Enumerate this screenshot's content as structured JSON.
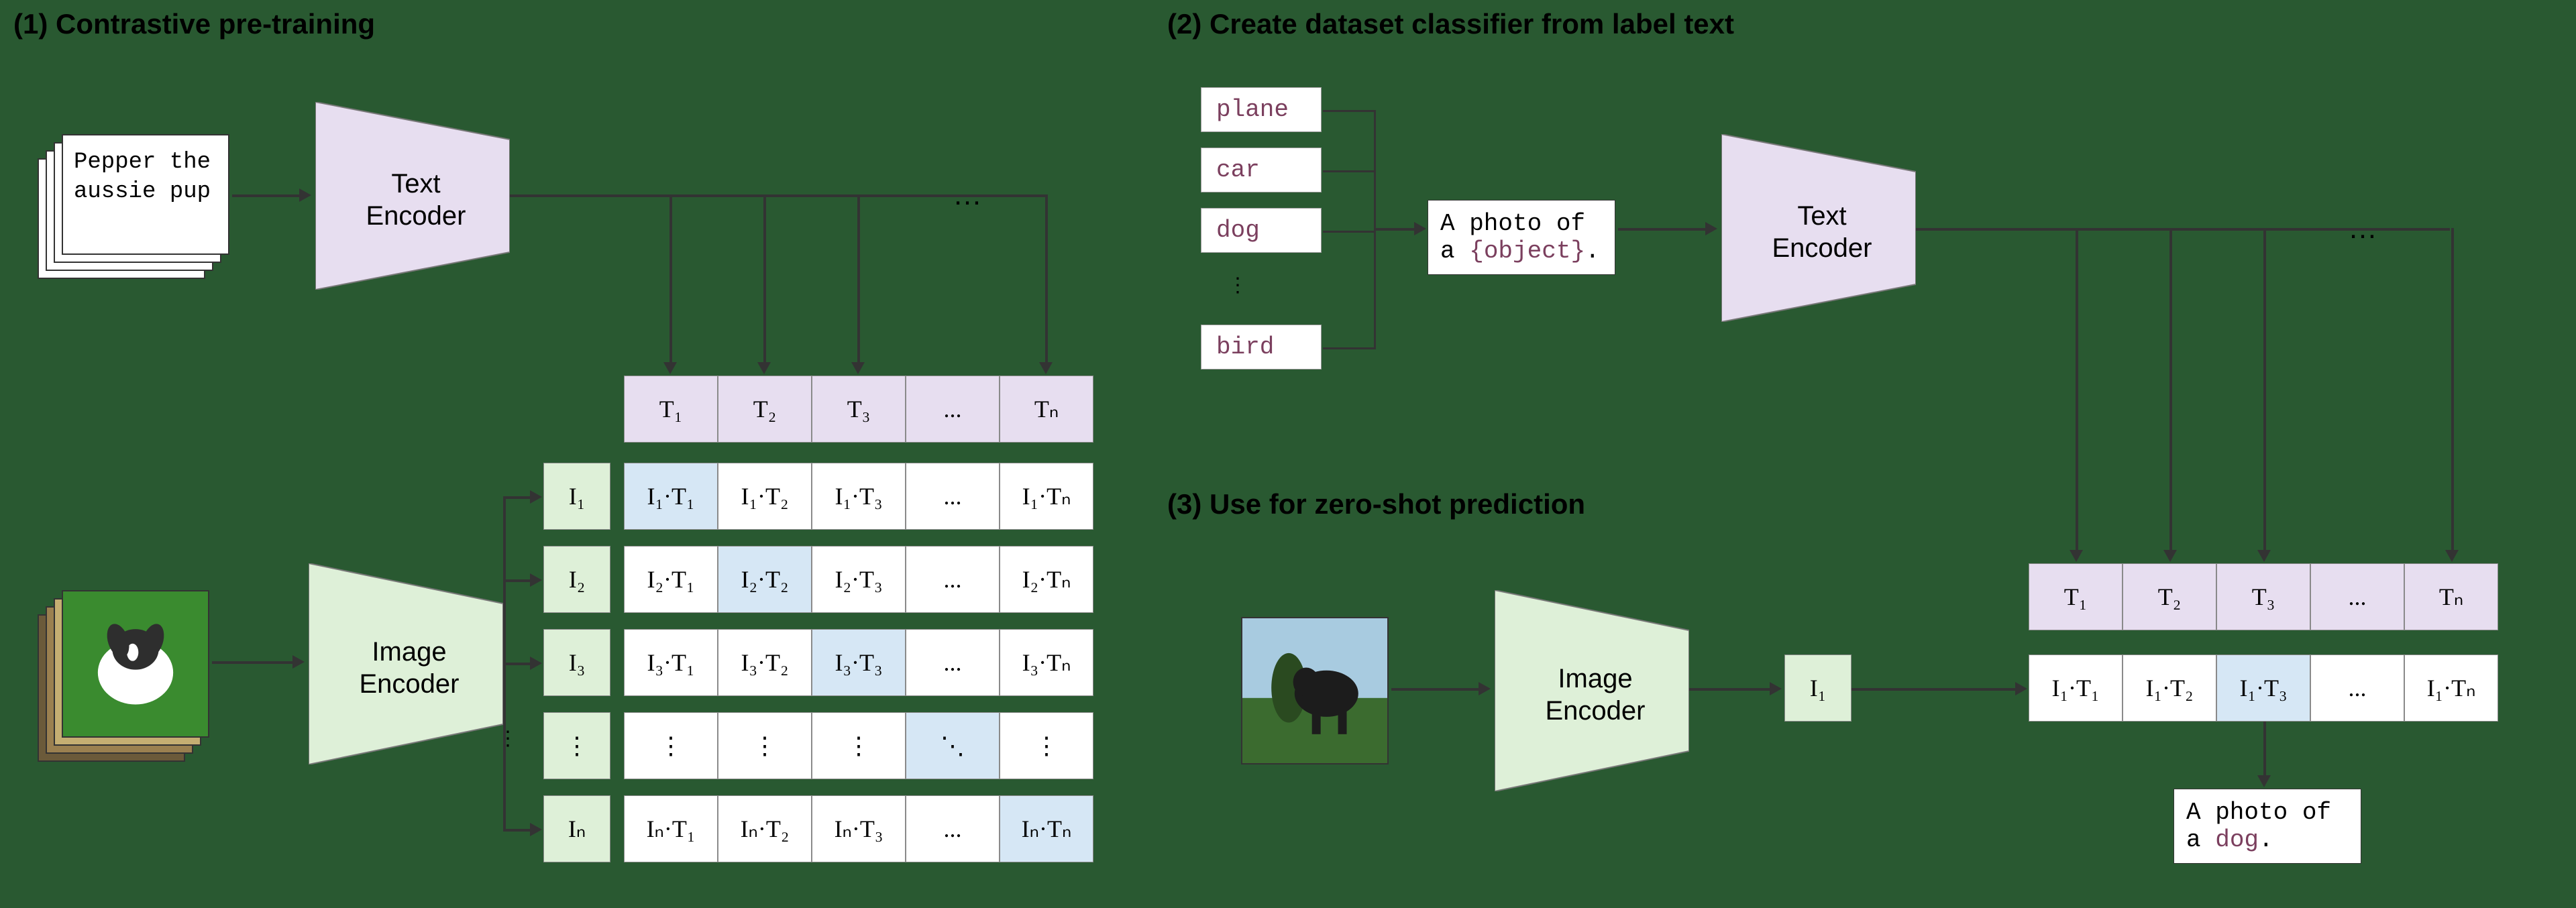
{
  "panel1": {
    "title": "(1) Contrastive pre-training",
    "doc_text": "Pepper the aussie pup",
    "text_encoder": "Text\nEncoder",
    "image_encoder": "Image\nEncoder",
    "T": [
      "T₁",
      "T₂",
      "T₃",
      "...",
      "Tₙ"
    ],
    "I": [
      "I₁",
      "I₂",
      "I₃",
      "⋮",
      "Iₙ"
    ],
    "matrix": [
      [
        "I₁·T₁",
        "I₁·T₂",
        "I₁·T₃",
        "...",
        "I₁·Tₙ"
      ],
      [
        "I₂·T₁",
        "I₂·T₂",
        "I₂·T₃",
        "...",
        "I₂·Tₙ"
      ],
      [
        "I₃·T₁",
        "I₃·T₂",
        "I₃·T₃",
        "...",
        "I₃·Tₙ"
      ],
      [
        "⋮",
        "⋮",
        "⋮",
        "⋱",
        "⋮"
      ],
      [
        "Iₙ·T₁",
        "Iₙ·T₂",
        "Iₙ·T₃",
        "...",
        "Iₙ·Tₙ"
      ]
    ]
  },
  "panel2": {
    "title": "(2) Create dataset classifier from label text",
    "labels": [
      "plane",
      "car",
      "dog",
      "bird"
    ],
    "prompt_pre": "A photo of a ",
    "prompt_obj": "{object}",
    "prompt_post": ".",
    "text_encoder": "Text\nEncoder"
  },
  "panel3": {
    "title": "(3) Use for zero-shot prediction",
    "image_encoder": "Image\nEncoder",
    "I_label": "I₁",
    "T": [
      "T₁",
      "T₂",
      "T₃",
      "...",
      "Tₙ"
    ],
    "row": [
      "I₁·T₁",
      "I₁·T₂",
      "I₁·T₃",
      "...",
      "I₁·Tₙ"
    ],
    "out_pre": "A photo of a ",
    "out_obj": "dog",
    "out_post": "."
  }
}
